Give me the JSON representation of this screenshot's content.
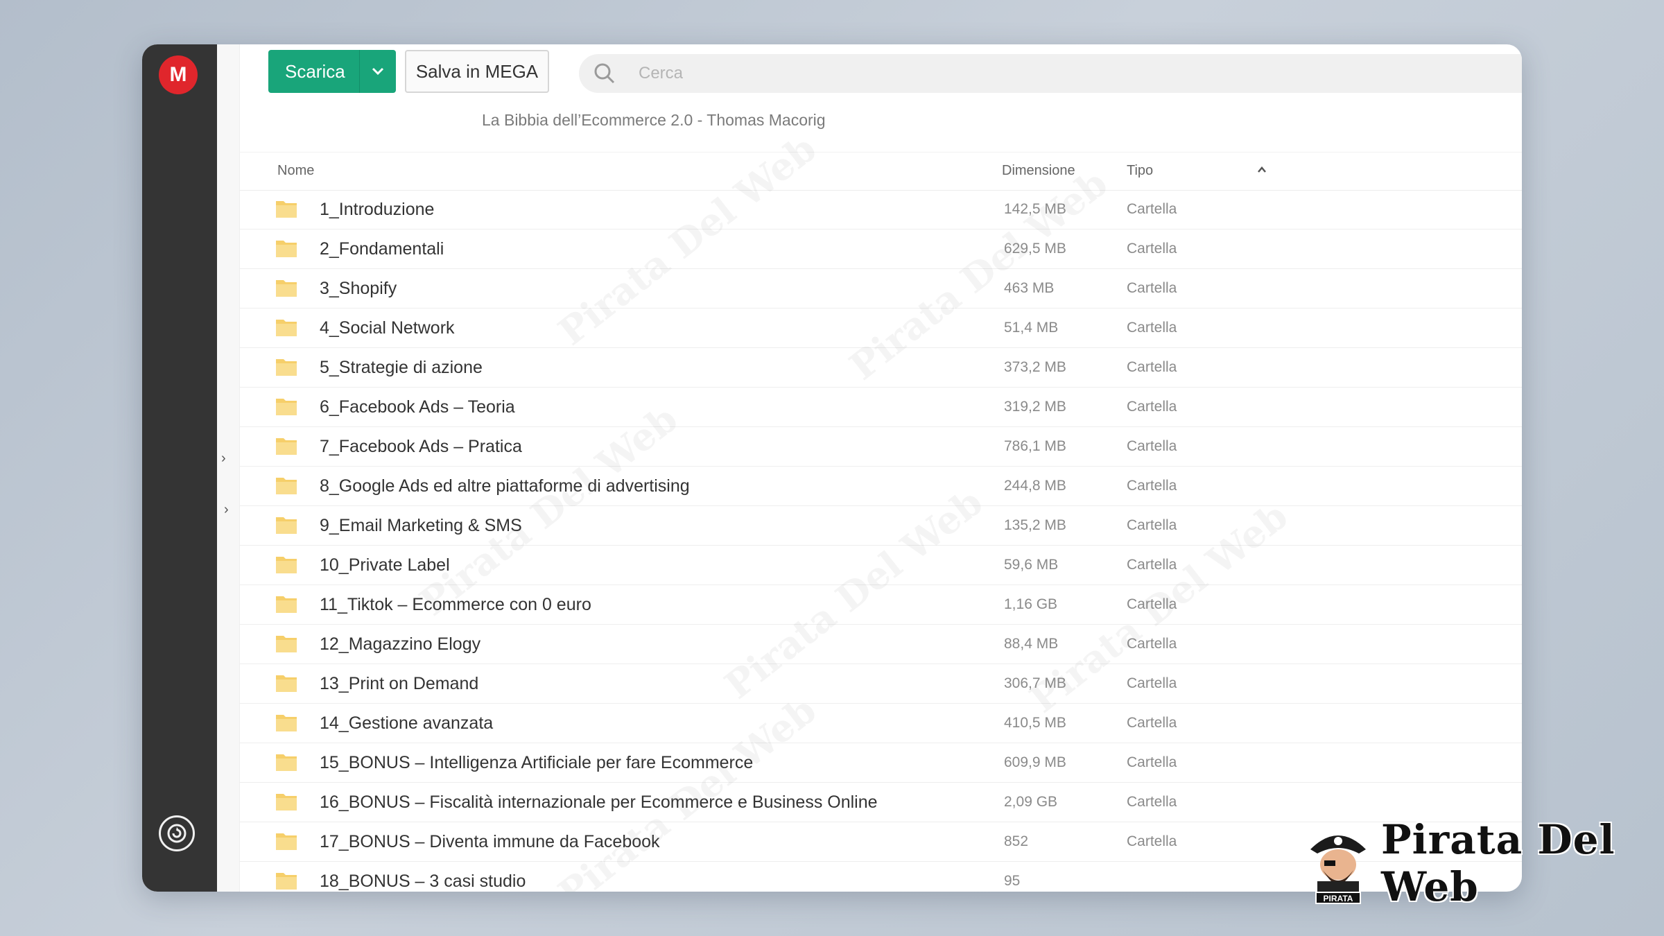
{
  "sidebar": {
    "logo": "M"
  },
  "toolbar": {
    "download_label": "Scarica",
    "save_label": "Salva in MEGA"
  },
  "search": {
    "placeholder": "Cerca",
    "icon": "search-icon"
  },
  "breadcrumb": "La Bibbia dell’Ecommerce 2.0 - Thomas Macorig",
  "columns": {
    "name": "Nome",
    "size": "Dimensione",
    "type": "Tipo"
  },
  "rows": [
    {
      "name": "1_Introduzione",
      "size": "142,5 MB",
      "type": "Cartella"
    },
    {
      "name": "2_Fondamentali",
      "size": "629,5 MB",
      "type": "Cartella"
    },
    {
      "name": "3_Shopify",
      "size": "463 MB",
      "type": "Cartella"
    },
    {
      "name": "4_Social Network",
      "size": "51,4 MB",
      "type": "Cartella"
    },
    {
      "name": "5_Strategie di azione",
      "size": "373,2 MB",
      "type": "Cartella"
    },
    {
      "name": "6_Facebook Ads – Teoria",
      "size": "319,2 MB",
      "type": "Cartella"
    },
    {
      "name": "7_Facebook Ads – Pratica",
      "size": "786,1 MB",
      "type": "Cartella"
    },
    {
      "name": "8_Google Ads ed altre piattaforme di advertising",
      "size": "244,8 MB",
      "type": "Cartella"
    },
    {
      "name": "9_Email Marketing & SMS",
      "size": "135,2 MB",
      "type": "Cartella"
    },
    {
      "name": "10_Private Label",
      "size": "59,6 MB",
      "type": "Cartella"
    },
    {
      "name": "11_Tiktok – Ecommerce con 0 euro",
      "size": "1,16 GB",
      "type": "Cartella"
    },
    {
      "name": "12_Magazzino Elogy",
      "size": "88,4 MB",
      "type": "Cartella"
    },
    {
      "name": "13_Print on Demand",
      "size": "306,7 MB",
      "type": "Cartella"
    },
    {
      "name": "14_Gestione avanzata",
      "size": "410,5 MB",
      "type": "Cartella"
    },
    {
      "name": "15_BONUS – Intelligenza Artificiale per fare Ecommerce",
      "size": "609,9 MB",
      "type": "Cartella"
    },
    {
      "name": "16_BONUS – Fiscalità internazionale per Ecommerce e Business Online",
      "size": "2,09 GB",
      "type": "Cartella"
    },
    {
      "name": "17_BONUS – Diventa immune da Facebook",
      "size": "852",
      "type": "Cartella"
    },
    {
      "name": "18_BONUS – 3 casi studio",
      "size": "95",
      "type": ""
    }
  ],
  "watermark_text": "Pirata Del Web",
  "brand": {
    "text": "Pirata Del Web",
    "badge": "PIRATA"
  },
  "colors": {
    "sidebar": "#343434",
    "download_button": "#19a57a",
    "mega_red": "#e0262c",
    "folder_yellow": "#f6cf6a"
  }
}
